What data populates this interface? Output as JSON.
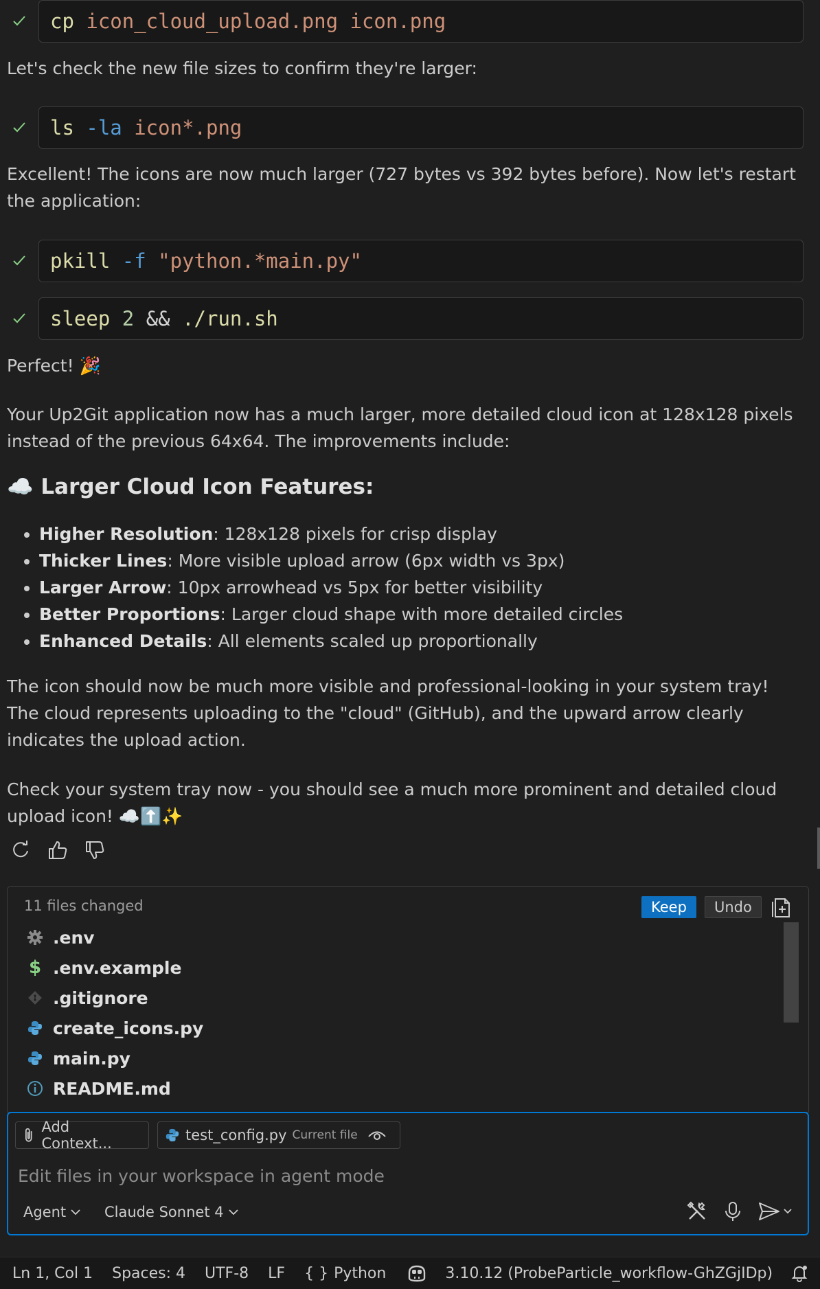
{
  "commands": [
    {
      "tokens": [
        {
          "t": "cp",
          "c": "c-yel"
        },
        {
          "t": " icon_cloud_upload.png icon.png",
          "c": "c-orn"
        }
      ]
    },
    {
      "tokens": [
        {
          "t": "ls",
          "c": "c-yel"
        },
        {
          "t": " -la",
          "c": "c-blu"
        },
        {
          "t": " icon*.png",
          "c": "c-orn"
        }
      ]
    },
    {
      "tokens": [
        {
          "t": "pkill",
          "c": "c-yel"
        },
        {
          "t": " -f",
          "c": "c-blu"
        },
        {
          "t": " \"python.*main.py\"",
          "c": "c-orn"
        }
      ]
    },
    {
      "tokens": [
        {
          "t": "sleep",
          "c": "c-yel"
        },
        {
          "t": " 2",
          "c": "c-grn"
        },
        {
          "t": " && ",
          "c": "c-wht"
        },
        {
          "t": "./run.sh",
          "c": "c-yel"
        }
      ]
    }
  ],
  "messages": {
    "check_sizes": "Let's check the new file sizes to confirm they're larger:",
    "excellent": "Excellent! The icons are now much larger (727 bytes vs 392 bytes before). Now let's restart the application:",
    "perfect": "Perfect! 🎉",
    "summary": "Your Up2Git application now has a much larger, more detailed cloud icon at 128x128 pixels instead of the previous 64x64. The improvements include:",
    "heading": "☁️ Larger Cloud Icon Features:",
    "features": [
      {
        "title": "Higher Resolution",
        "text": ": 128x128 pixels for crisp display"
      },
      {
        "title": "Thicker Lines",
        "text": ": More visible upload arrow (6px width vs 3px)"
      },
      {
        "title": "Larger Arrow",
        "text": ": 10px arrowhead vs 5px for better visibility"
      },
      {
        "title": "Better Proportions",
        "text": ": Larger cloud shape with more detailed circles"
      },
      {
        "title": "Enhanced Details",
        "text": ": All elements scaled up proportionally"
      }
    ],
    "visible": "The icon should now be much more visible and professional-looking in your system tray! The cloud represents uploading to the \"cloud\" (GitHub), and the upward arrow clearly indicates the upload action.",
    "check_tray": "Check your system tray now - you should see a much more prominent and detailed cloud upload icon! ☁️⬆️✨"
  },
  "changes": {
    "count_label": "11 files changed",
    "keep_label": "Keep",
    "undo_label": "Undo",
    "files": [
      {
        "name": ".env",
        "icon": "gear-icon"
      },
      {
        "name": ".env.example",
        "icon": "dollar-icon"
      },
      {
        "name": ".gitignore",
        "icon": "git-icon"
      },
      {
        "name": "create_icons.py",
        "icon": "python-icon"
      },
      {
        "name": "main.py",
        "icon": "python-icon"
      },
      {
        "name": "README.md",
        "icon": "info-icon"
      }
    ]
  },
  "input": {
    "add_context": "Add Context...",
    "file_chip": "test_config.py",
    "file_chip_note": "Current file",
    "placeholder": "Edit files in your workspace in agent mode",
    "mode": "Agent",
    "model": "Claude Sonnet 4"
  },
  "status": {
    "position": "Ln 1, Col 1",
    "spaces": "Spaces: 4",
    "encoding": "UTF-8",
    "eol": "LF",
    "language": "Python",
    "interpreter": "3.10.12 (ProbeParticle_workflow-GhZGjIDp)"
  },
  "colors": {
    "accent": "#0e70c0",
    "focus_border": "#0078d4",
    "check": "#89d185",
    "background": "#1f1f1f"
  }
}
